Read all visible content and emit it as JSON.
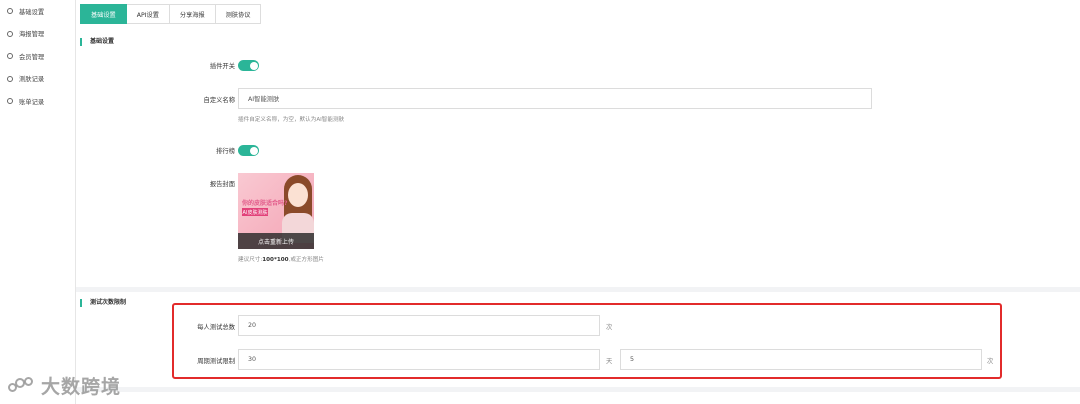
{
  "sidebar": {
    "items": [
      {
        "label": "基础设置"
      },
      {
        "label": "海报管理"
      },
      {
        "label": "会员管理"
      },
      {
        "label": "测肤记录"
      },
      {
        "label": "账单记录"
      }
    ]
  },
  "tabs": [
    {
      "label": "基础设置",
      "active": true
    },
    {
      "label": "API设置",
      "active": false
    },
    {
      "label": "分享海报",
      "active": false
    },
    {
      "label": "测肤协议",
      "active": false
    }
  ],
  "basic": {
    "section_title": "基础设置",
    "plugin_switch_label": "插件开关",
    "plugin_switch_on": true,
    "custom_name_label": "自定义名称",
    "custom_name_value": "AI智能测肤",
    "custom_name_hint": "插件自定义名称，为空，默认为AI智能测肤",
    "ranking_label": "排行榜",
    "ranking_on": true,
    "report_cover_label": "报告封面",
    "poster_text": "你的皮肤适合吗?",
    "poster_button": "AI皮肤测肤",
    "upload_overlay": "点击重新上传",
    "size_hint_prefix": "建议尺寸:",
    "size_hint_size": "100*100",
    "size_hint_suffix": ",或正方形图片"
  },
  "limits": {
    "section_title": "测试次数限制",
    "per_person_label": "每人测试总数",
    "per_person_value": "20",
    "per_person_unit": "次",
    "period_label": "周期测试限制",
    "period_days": "30",
    "period_days_unit": "天",
    "period_times": "5",
    "period_times_unit": "次"
  },
  "watermark": {
    "text": "大数跨境"
  },
  "colors": {
    "accent": "#2bb598",
    "highlight": "#e22b2b"
  }
}
